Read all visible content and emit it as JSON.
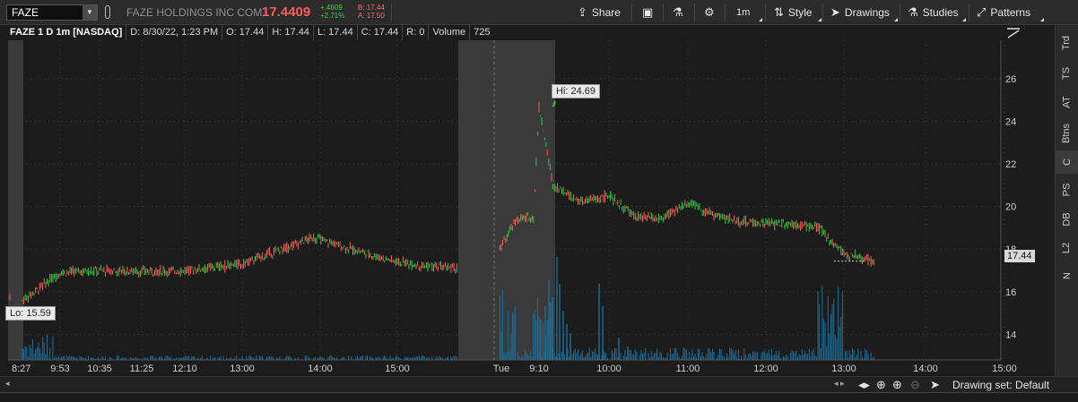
{
  "toolbar": {
    "symbol": "FAZE",
    "company": "FAZE HOLDINGS INC COM",
    "last_price": "17.4409",
    "net_change": "+.4609",
    "pct_change": "+2.71%",
    "bid": "B: 17.44",
    "ask": "A: 17.50",
    "share_label": "Share",
    "timeframe_label": "1m",
    "style_label": "Style",
    "drawings_label": "Drawings",
    "studies_label": "Studies",
    "patterns_label": "Patterns"
  },
  "infobar": {
    "title": "FAZE 1 D 1m [NASDAQ]",
    "date": "D: 8/30/22, 1:23 PM",
    "open": "O: 17.44",
    "high": "H: 17.44",
    "low": "L: 17.44",
    "close": "C: 17.44",
    "range": "R: 0",
    "volume_label": "Volume",
    "volume_value": "725"
  },
  "annotations": {
    "hi": "Hi: 24.69",
    "lo": "Lo: 15.59",
    "current_price": "17.44"
  },
  "right_tabs": [
    "Trd",
    "TS",
    "AT",
    "Btns",
    "C",
    "PS",
    "DB",
    "L2",
    "N"
  ],
  "active_right_tab": "C",
  "bottom": {
    "drawing_set": "Drawing set: Default"
  },
  "colors": {
    "up": "#2ecc40",
    "down": "#ff5b5b",
    "volume": "#1c6f9c",
    "background": "#1c1c1c",
    "session_shade": "#3a3a3a"
  },
  "chart_data": {
    "type": "candlestick",
    "ylim": [
      12.8,
      27.8
    ],
    "y_ticks": [
      14,
      16,
      18,
      20,
      22,
      24,
      26
    ],
    "x_ticks": [
      "8:27",
      "9:53",
      "10:35",
      "11:25",
      "12:10",
      "13:00",
      "14:00",
      "15:00",
      "Tue",
      "9:10",
      "10:00",
      "11:00",
      "12:00",
      "13:00",
      "14:00",
      "15:00"
    ],
    "price_path_day1": [
      [
        "8:27",
        15.59
      ],
      [
        "9:53",
        16.9
      ],
      [
        "10:35",
        17.0
      ],
      [
        "11:25",
        16.95
      ],
      [
        "12:10",
        17.0
      ],
      [
        "13:00",
        17.3
      ],
      [
        "13:30",
        18.0
      ],
      [
        "13:55",
        18.55
      ],
      [
        "14:30",
        17.9
      ],
      [
        "15:00",
        17.4
      ],
      [
        "15:30",
        17.2
      ],
      [
        "16:00",
        17.1
      ]
    ],
    "price_path_day2": [
      [
        "8:00",
        18.0
      ],
      [
        "8:30",
        19.4
      ],
      [
        "9:00",
        19.5
      ],
      [
        "9:10",
        24.69
      ],
      [
        "9:20",
        21.0
      ],
      [
        "9:40",
        20.2
      ],
      [
        "10:00",
        20.5
      ],
      [
        "10:20",
        19.5
      ],
      [
        "10:40",
        19.4
      ],
      [
        "11:00",
        20.2
      ],
      [
        "11:20",
        19.6
      ],
      [
        "11:40",
        19.3
      ],
      [
        "12:00",
        19.2
      ],
      [
        "12:20",
        19.2
      ],
      [
        "12:40",
        19.0
      ],
      [
        "13:00",
        17.8
      ],
      [
        "13:23",
        17.44
      ]
    ],
    "high": 24.69,
    "low": 15.59,
    "last": 17.44
  }
}
